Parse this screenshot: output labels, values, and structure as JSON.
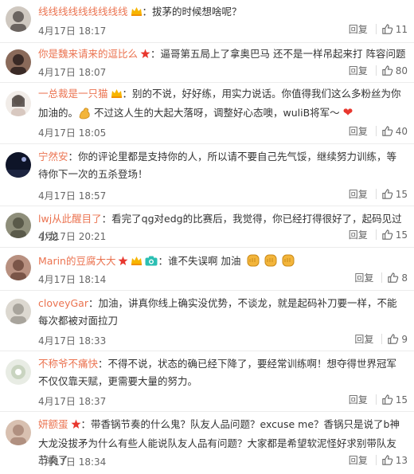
{
  "comments": [
    {
      "user": "线线线线线线线线线",
      "badges": [
        "vip"
      ],
      "text": "：拔茅的时候想啥呢？",
      "time": "4月17日 18:17",
      "reply": "回复",
      "likes": "11",
      "avatar": "#6b6460"
    },
    {
      "user": "你是魏来请来的逗比么",
      "badges": [
        "red-star"
      ],
      "text": "：逼哥第五局上了拿奥巴马 还不是一样吊起来打 阵容问题",
      "time": "4月17日 18:07",
      "reply": "回复",
      "likes": "80",
      "avatar": "#3a2a26"
    },
    {
      "user": "一总裁是一只猫",
      "badges": [
        "vip"
      ],
      "text_1": "：别的不说，好好练，用实力说话。你值得我们这么多粉丝为你加油的。",
      "text_2": "不过这人生的大起大落呀，调整好心态噢，wuliB将军～",
      "heart": "❤",
      "time": "4月17日 18:05",
      "reply": "回复",
      "likes": "40",
      "avatar": "#d8c8c0"
    },
    {
      "user": "宁然安",
      "badges": [],
      "text": "：你的评论里都是支持你的人，所以请不要自己先气馁，继续努力训练，等待你下一次的五杀登场！",
      "time": "4月17日 18:57",
      "reply": "回复",
      "likes": "15",
      "avatar": "#1c2440"
    },
    {
      "user": "lwj从此醒目了",
      "badges": [],
      "text": "：看完了qg对edg的比赛后，我觉得，你已经打得很好了，起码见过小龙",
      "time": "4月17日 20:21",
      "reply": "回复",
      "likes": "15",
      "avatar": "#5a5a4a"
    },
    {
      "user": "Marin的豆腐大大",
      "badges": [
        "red-star",
        "vip",
        "camera"
      ],
      "text": "：谁不失误啊 加油",
      "time": "4月17日 18:14",
      "reply": "回复",
      "likes": "8",
      "avatar": "#7a5548"
    },
    {
      "user": "cloveyGar",
      "badges": [],
      "text": "：加油，讲真你线上确实没优势，不谈龙，就是起码补刀要一样，不能每次都被对面拉刀",
      "time": "4月17日 18:33",
      "reply": "回复",
      "likes": "9",
      "avatar": "#a8a49c"
    },
    {
      "user": "不称爷不痛快",
      "badges": [],
      "text": "：不得不说，状态的确已经下降了，要经常训练啊！想夺得世界冠军不仅仅靠天赋，更需要大量的努力。",
      "time": "4月17日 18:37",
      "reply": "回复",
      "likes": "15",
      "avatar": "#c9d4c0"
    },
    {
      "user": "妍额蛋",
      "badges": [
        "red-star"
      ],
      "text": "：带香锅节奏的什么鬼？队友人品问题？excuse me？香锅只是说了b神大龙没拔矛为什么有些人能说队友人品有问题？大家都是希望软泥怪好求别带队友节奏了",
      "time": "4月17日 18:34",
      "reply": "回复",
      "likes": "13",
      "avatar": "#b09080"
    }
  ]
}
